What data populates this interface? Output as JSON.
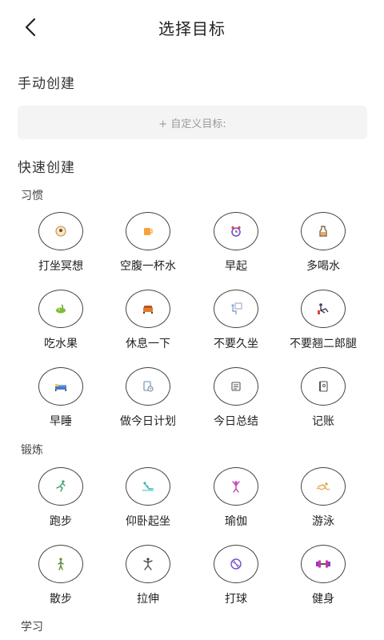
{
  "header": {
    "title": "选择目标"
  },
  "manual": {
    "section_title": "手动创建",
    "custom_button": "+ 自定义目标:"
  },
  "quick": {
    "section_title": "快速创建"
  },
  "categories": [
    {
      "title": "习惯",
      "items": [
        {
          "label": "打坐冥想",
          "icon": "meditation-icon"
        },
        {
          "label": "空腹一杯水",
          "icon": "cup-icon"
        },
        {
          "label": "早起",
          "icon": "alarm-clock-icon"
        },
        {
          "label": "多喝水",
          "icon": "water-bottle-icon"
        },
        {
          "label": "吃水果",
          "icon": "fruit-icon"
        },
        {
          "label": "休息一下",
          "icon": "sofa-icon"
        },
        {
          "label": "不要久坐",
          "icon": "sitting-person-icon"
        },
        {
          "label": "不要翘二郎腿",
          "icon": "crossed-legs-icon"
        },
        {
          "label": "早睡",
          "icon": "bed-icon"
        },
        {
          "label": "做今日计划",
          "icon": "plan-doc-icon"
        },
        {
          "label": "今日总结",
          "icon": "summary-doc-icon"
        },
        {
          "label": "记账",
          "icon": "ledger-icon"
        }
      ]
    },
    {
      "title": "锻炼",
      "items": [
        {
          "label": "跑步",
          "icon": "running-icon"
        },
        {
          "label": "仰卧起坐",
          "icon": "situp-icon"
        },
        {
          "label": "瑜伽",
          "icon": "yoga-icon"
        },
        {
          "label": "游泳",
          "icon": "swimming-icon"
        },
        {
          "label": "散步",
          "icon": "walking-icon"
        },
        {
          "label": "拉伸",
          "icon": "stretching-icon"
        },
        {
          "label": "打球",
          "icon": "ball-icon"
        },
        {
          "label": "健身",
          "icon": "dumbbell-icon"
        }
      ]
    },
    {
      "title": "学习",
      "items": []
    }
  ]
}
